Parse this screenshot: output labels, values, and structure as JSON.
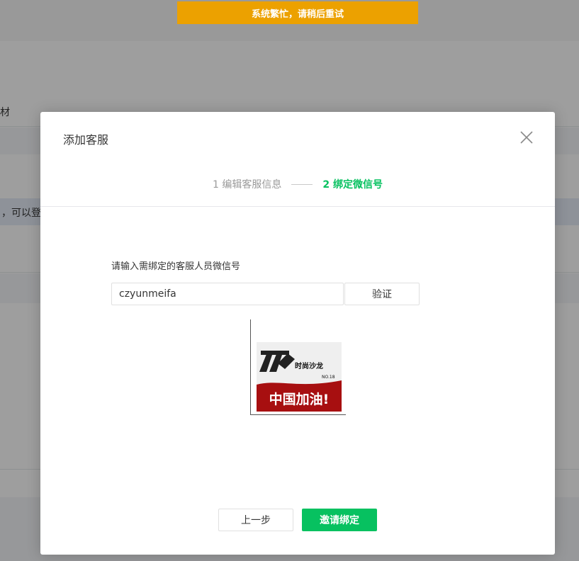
{
  "toast": {
    "message": "系统繁忙，请稍后重试"
  },
  "background": {
    "partial_tab_text": "材",
    "partial_notice_text": "，可以登录"
  },
  "dialog": {
    "title": "添加客服",
    "steps": [
      {
        "label": "1 编辑客服信息",
        "state": "done"
      },
      {
        "label": "2 绑定微信号",
        "state": "active"
      }
    ],
    "wechat_field": {
      "label": "请输入需绑定的客服人员微信号",
      "value": "czyunmeifa"
    },
    "verify_label": "验证",
    "avatar": {
      "icon": "avatar-image",
      "text_brand": "时尚沙龙",
      "text_no": "NO.18",
      "text_slogan": "中国加油!"
    },
    "buttons": {
      "prev_label": "上一步",
      "invite_label": "邀请绑定"
    }
  },
  "colors": {
    "accent": "#07c160",
    "toast_bg": "#eca100",
    "avatar_red": "#a70f10"
  }
}
